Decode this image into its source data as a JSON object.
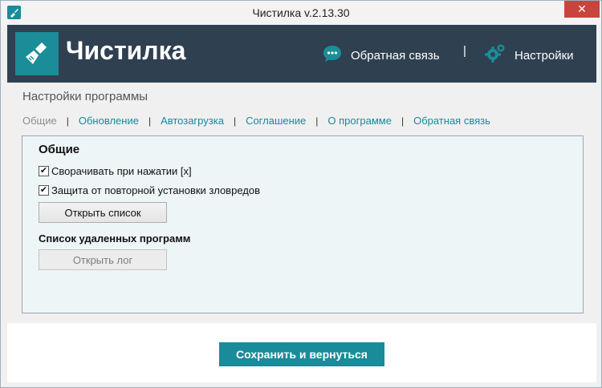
{
  "window": {
    "title": "Чистилка v.2.13.30",
    "close_glyph": "✕"
  },
  "header": {
    "brand": "Чистилка",
    "feedback_label": "Обратная связь",
    "separator": "|",
    "settings_label": "Настройки",
    "logo_icon": "broom-icon",
    "feedback_icon": "chat-bubble-icon",
    "settings_icon": "gears-icon"
  },
  "page": {
    "section_title": "Настройки программы",
    "tabs": [
      {
        "label": "Общие",
        "active": true
      },
      {
        "label": "Обновление",
        "active": false
      },
      {
        "label": "Автозагрузка",
        "active": false
      },
      {
        "label": "Соглашение",
        "active": false
      },
      {
        "label": "О программе",
        "active": false
      },
      {
        "label": "Обратная связь",
        "active": false
      }
    ],
    "tab_separator": "|"
  },
  "panel": {
    "heading": "Общие",
    "checkbox1": {
      "label": "Сворачивать при нажатии [x]",
      "checked": true
    },
    "checkbox2": {
      "label": "Защита от повторной установки зловредов",
      "checked": true
    },
    "open_list_button": "Открыть список",
    "removed_programs_heading": "Список удаленных программ",
    "open_log_button": "Открыть лог",
    "check_glyph": "✔"
  },
  "footer": {
    "save_button": "Сохранить и вернуться"
  },
  "colors": {
    "header_bg": "#2f4051",
    "accent": "#1a8b9b",
    "tab_link": "#1c86a0",
    "close_button": "#c7453c",
    "panel_bg": "#eef5f6"
  }
}
